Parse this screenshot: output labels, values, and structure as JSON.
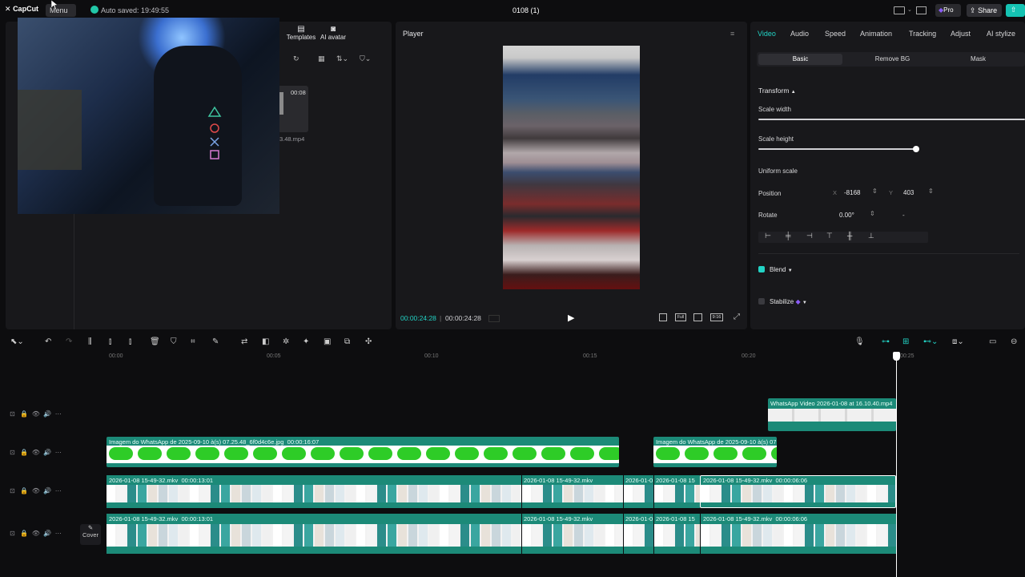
{
  "app": {
    "logo": "CapCut",
    "menu_label": "Menu",
    "autosave": "Auto saved: 19:49:55",
    "project_title": "0108 (1)",
    "pro_label": "Pro",
    "share_label": "Share"
  },
  "media": {
    "tabs": [
      {
        "label": "Templates",
        "icon": "templates-icon"
      },
      {
        "label": "AI avatar",
        "icon": "avatar-icon"
      }
    ],
    "thumb_duration": "00:08",
    "thumb_filename": "3.48.mp4"
  },
  "player": {
    "title": "Player",
    "time_current": "00:00:24:28",
    "time_total": "00:00:24:28",
    "full_label": "Full",
    "ratio_label": "9:16"
  },
  "inspector": {
    "tabs": [
      "Video",
      "Audio",
      "Speed",
      "Animation",
      "Tracking",
      "Adjust",
      "AI stylize"
    ],
    "active_tab": "Video",
    "subtabs": [
      "Basic",
      "Remove BG",
      "Mask"
    ],
    "transform_label": "Transform",
    "scale_width_label": "Scale width",
    "scale_width_value": 1.0,
    "scale_height_label": "Scale height",
    "scale_height_value": 0.6,
    "uniform_scale_label": "Uniform scale",
    "position_label": "Position",
    "pos_x_prefix": "X",
    "pos_x": "-8168",
    "pos_y_prefix": "Y",
    "pos_y": "403",
    "rotate_label": "Rotate",
    "rotate_value": "0.00°",
    "rotate_extra": "-",
    "blend_label": "Blend",
    "stabilize_label": "Stabilize"
  },
  "timeline": {
    "ruler": [
      "00:00",
      "00:05",
      "00:10",
      "00:15",
      "00:20",
      "00:25"
    ],
    "cover_label": "Cover",
    "tracks": [
      {
        "clips": [
          {
            "label": "WhatsApp Video 2026-01-08 at 16.10.40.mp4"
          }
        ]
      },
      {
        "clips": [
          {
            "label": "Imagem do WhatsApp de 2025-09-10 à(s) 07.25.48_6f0d4c6e.jpg",
            "duration": "00:00:16:07"
          },
          {
            "label": "Imagem do WhatsApp de 2025-09-10 à(s) 07"
          }
        ]
      },
      {
        "clips": [
          {
            "label": "2026-01-08 15-49-32.mkv",
            "duration": "00:00:13:01"
          },
          {
            "label": "2026-01-08 15-49-32.mkv"
          },
          {
            "label": "2026-01-0"
          },
          {
            "label": "2026-01-08 15"
          },
          {
            "label": "2026-01-08 15-49-32.mkv",
            "duration": "00:00:06:06"
          }
        ]
      },
      {
        "clips": [
          {
            "label": "2026-01-08 15-49-32.mkv",
            "duration": "00:00:13:01"
          },
          {
            "label": "2026-01-08 15-49-32.mkv"
          },
          {
            "label": "2026-01-0"
          },
          {
            "label": "2026-01-08 15"
          },
          {
            "label": "2026-01-08 15-49-32.mkv",
            "duration": "00:00:06:06"
          }
        ]
      }
    ]
  },
  "colors": {
    "accent": "#22d3c5",
    "clip_teal": "#1c8a78",
    "green": "#2ecc27",
    "pro": "#8b5cf6"
  }
}
